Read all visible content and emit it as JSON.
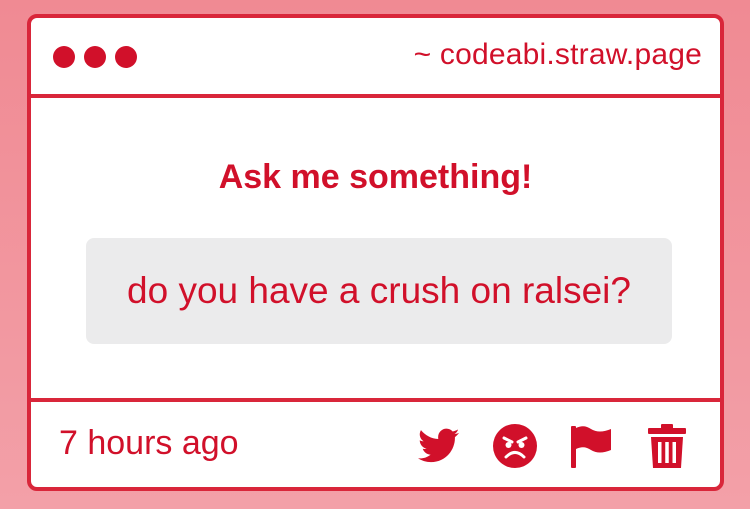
{
  "header": {
    "url": "~ codeabi.straw.page"
  },
  "main": {
    "heading": "Ask me something!",
    "question": "do you have a crush on ralsei?"
  },
  "footer": {
    "timestamp": "7 hours ago",
    "actions": [
      "twitter-icon",
      "angry-face-icon",
      "flag-icon",
      "trash-icon"
    ]
  },
  "colors": {
    "accent": "#d1102a",
    "border": "#d9263a",
    "question_bg": "#ebebec",
    "background": "#f08a93"
  }
}
